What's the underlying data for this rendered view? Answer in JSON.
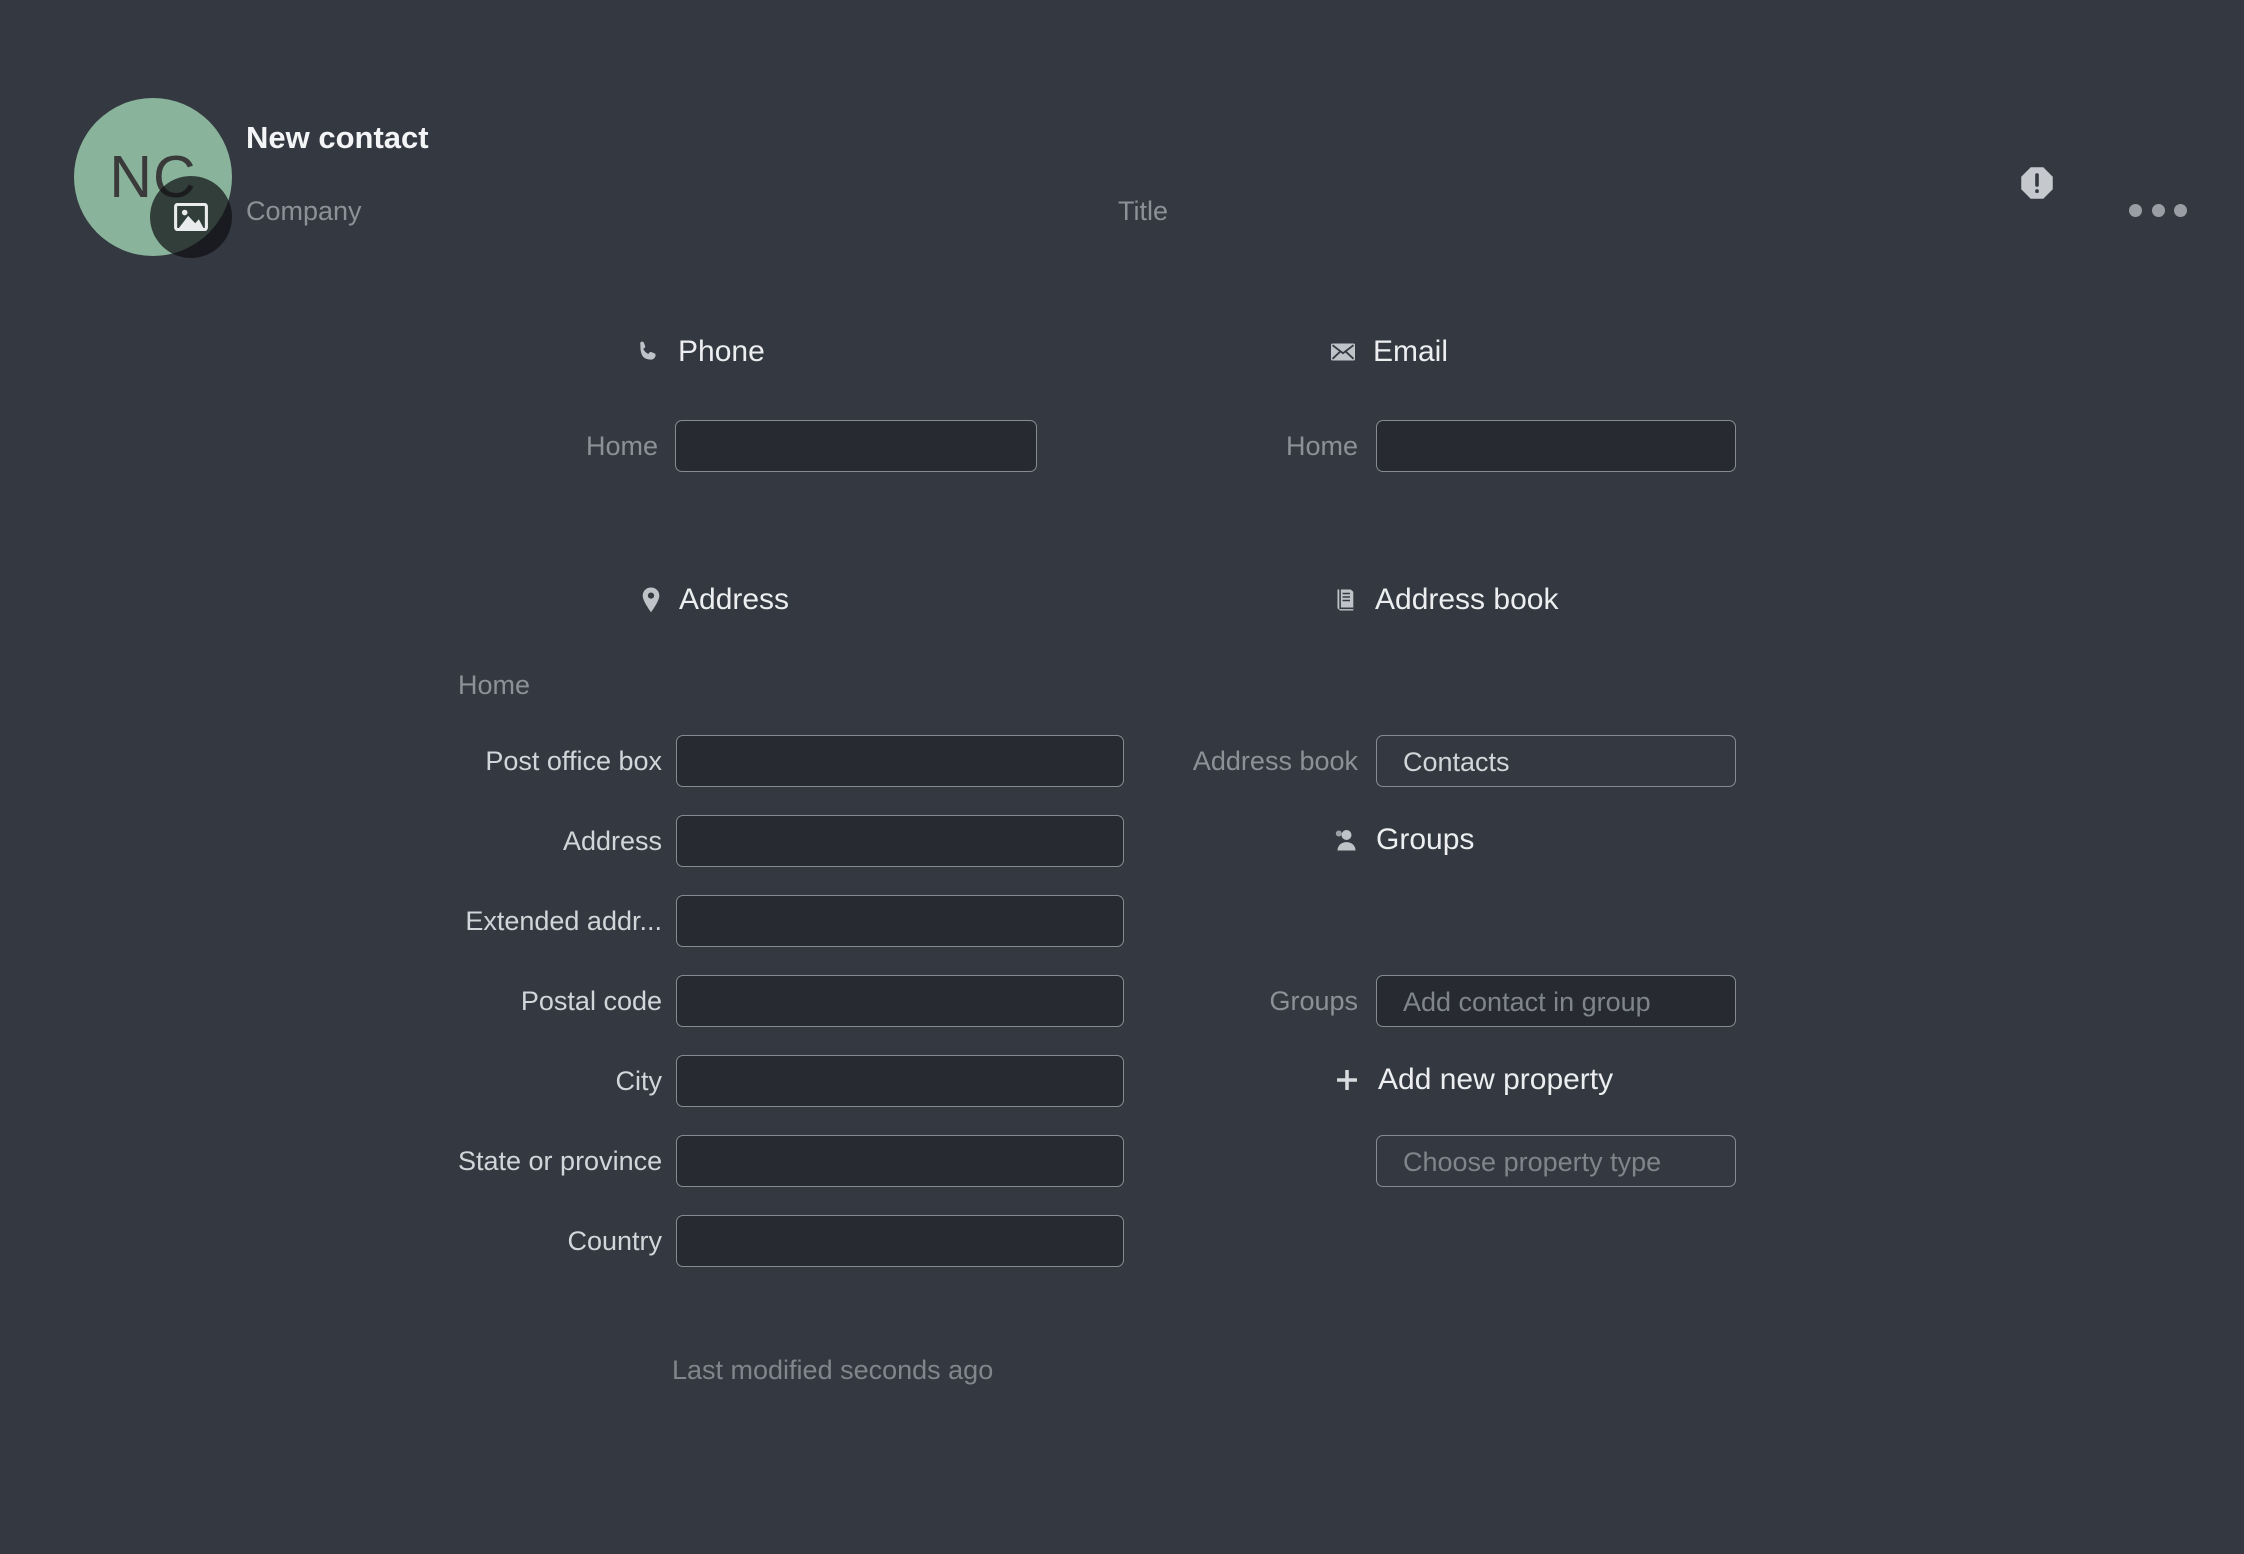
{
  "header": {
    "avatar_initials": "NC",
    "avatar_color": "#8ab39c",
    "photo_badge_icon": "image-icon",
    "contact_name": "New contact",
    "company_placeholder": "Company",
    "title_placeholder": "Title",
    "warning_icon": "exclamation-octagon-icon",
    "more_icon": "ellipsis-icon"
  },
  "sections": {
    "phone": {
      "icon": "phone-icon",
      "label": "Phone",
      "rows": [
        {
          "label": "Home",
          "value": "",
          "placeholder": ""
        }
      ]
    },
    "email": {
      "icon": "envelope-icon",
      "label": "Email",
      "rows": [
        {
          "label": "Home",
          "value": "",
          "placeholder": ""
        }
      ]
    },
    "address": {
      "icon": "map-pin-icon",
      "label": "Address",
      "group_label": "Home",
      "rows": [
        {
          "label": "Post office box",
          "value": ""
        },
        {
          "label": "Address",
          "value": ""
        },
        {
          "label": "Extended addr...",
          "value": ""
        },
        {
          "label": "Postal code",
          "value": ""
        },
        {
          "label": "City",
          "value": ""
        },
        {
          "label": "State or province",
          "value": ""
        },
        {
          "label": "Country",
          "value": ""
        }
      ]
    },
    "address_book": {
      "icon": "book-icon",
      "label": "Address book",
      "rows": [
        {
          "label": "Address book",
          "value": "Contacts"
        }
      ]
    },
    "groups": {
      "icon": "person-icon",
      "label": "Groups",
      "rows": [
        {
          "label": "Groups",
          "value": "",
          "placeholder": "Add contact in group"
        }
      ]
    },
    "add_property": {
      "icon": "plus-icon",
      "label": "Add new property",
      "input_placeholder": "Choose property type"
    }
  },
  "footer": {
    "last_modified": "Last modified seconds ago"
  },
  "colors": {
    "background": "#343840",
    "field_fill": "#272a30",
    "field_border": "#868b92",
    "accent_avatar": "#8ab39c",
    "text_primary": "#eceef0",
    "text_secondary": "#d2d5d9",
    "text_muted": "#8d9197"
  }
}
